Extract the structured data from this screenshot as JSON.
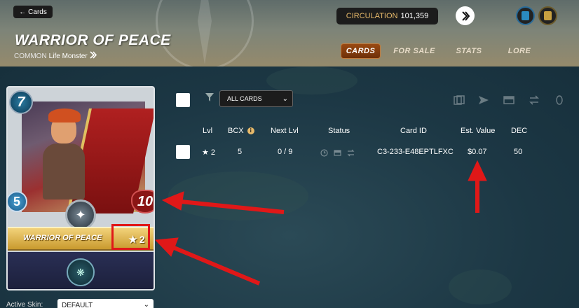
{
  "header": {
    "back_label": "Cards",
    "title": "WARRIOR OF PEACE",
    "rarity": "COMMON",
    "type_label": "Life Monster",
    "circulation_label": "CIRCULATION",
    "circulation_value": "101,359"
  },
  "tabs": [
    {
      "label": "CARDS",
      "active": true
    },
    {
      "label": "FOR SALE",
      "active": false
    },
    {
      "label": "STATS",
      "active": false
    },
    {
      "label": "LORE",
      "active": false
    }
  ],
  "card": {
    "mana": "7",
    "speed": "5",
    "health": "10",
    "name": "WARRIOR OF PEACE",
    "level": "2",
    "level_star": "★"
  },
  "skin": {
    "label": "Active Skin:",
    "value": "DEFAULT"
  },
  "toolbar": {
    "filter_value": "ALL CARDS"
  },
  "table": {
    "headers": [
      "Lvl",
      "BCX",
      "Next Lvl",
      "Status",
      "Card ID",
      "Est. Value",
      "DEC"
    ],
    "rows": [
      {
        "lvl": "★ 2",
        "bcx": "5",
        "next_lvl": "0 / 9",
        "card_id": "C3-233-E48EPTLFXC",
        "est_value": "$0.07",
        "dec": "50"
      }
    ]
  },
  "colors": {
    "accent_gold": "#e6b96a",
    "tab_active": "#8a4010",
    "annotation_red": "#e01818"
  }
}
